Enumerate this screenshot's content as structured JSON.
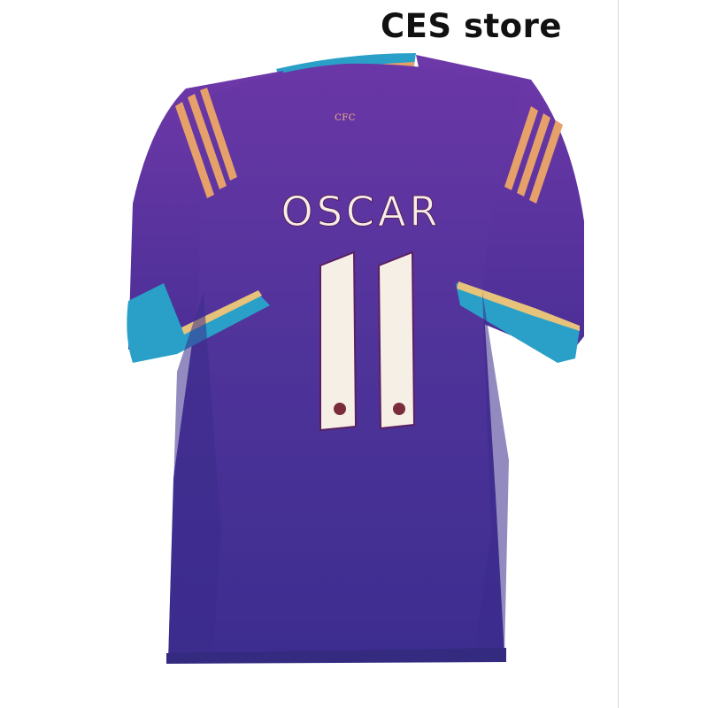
{
  "store": {
    "label": "CES store"
  },
  "jersey": {
    "crest": "CFC",
    "player_name": "OSCAR",
    "colors": {
      "body": "#5b3399",
      "body_dark": "#3c2a8a",
      "trim": "#2aa0c8",
      "stripe": "#e6a06a"
    }
  }
}
